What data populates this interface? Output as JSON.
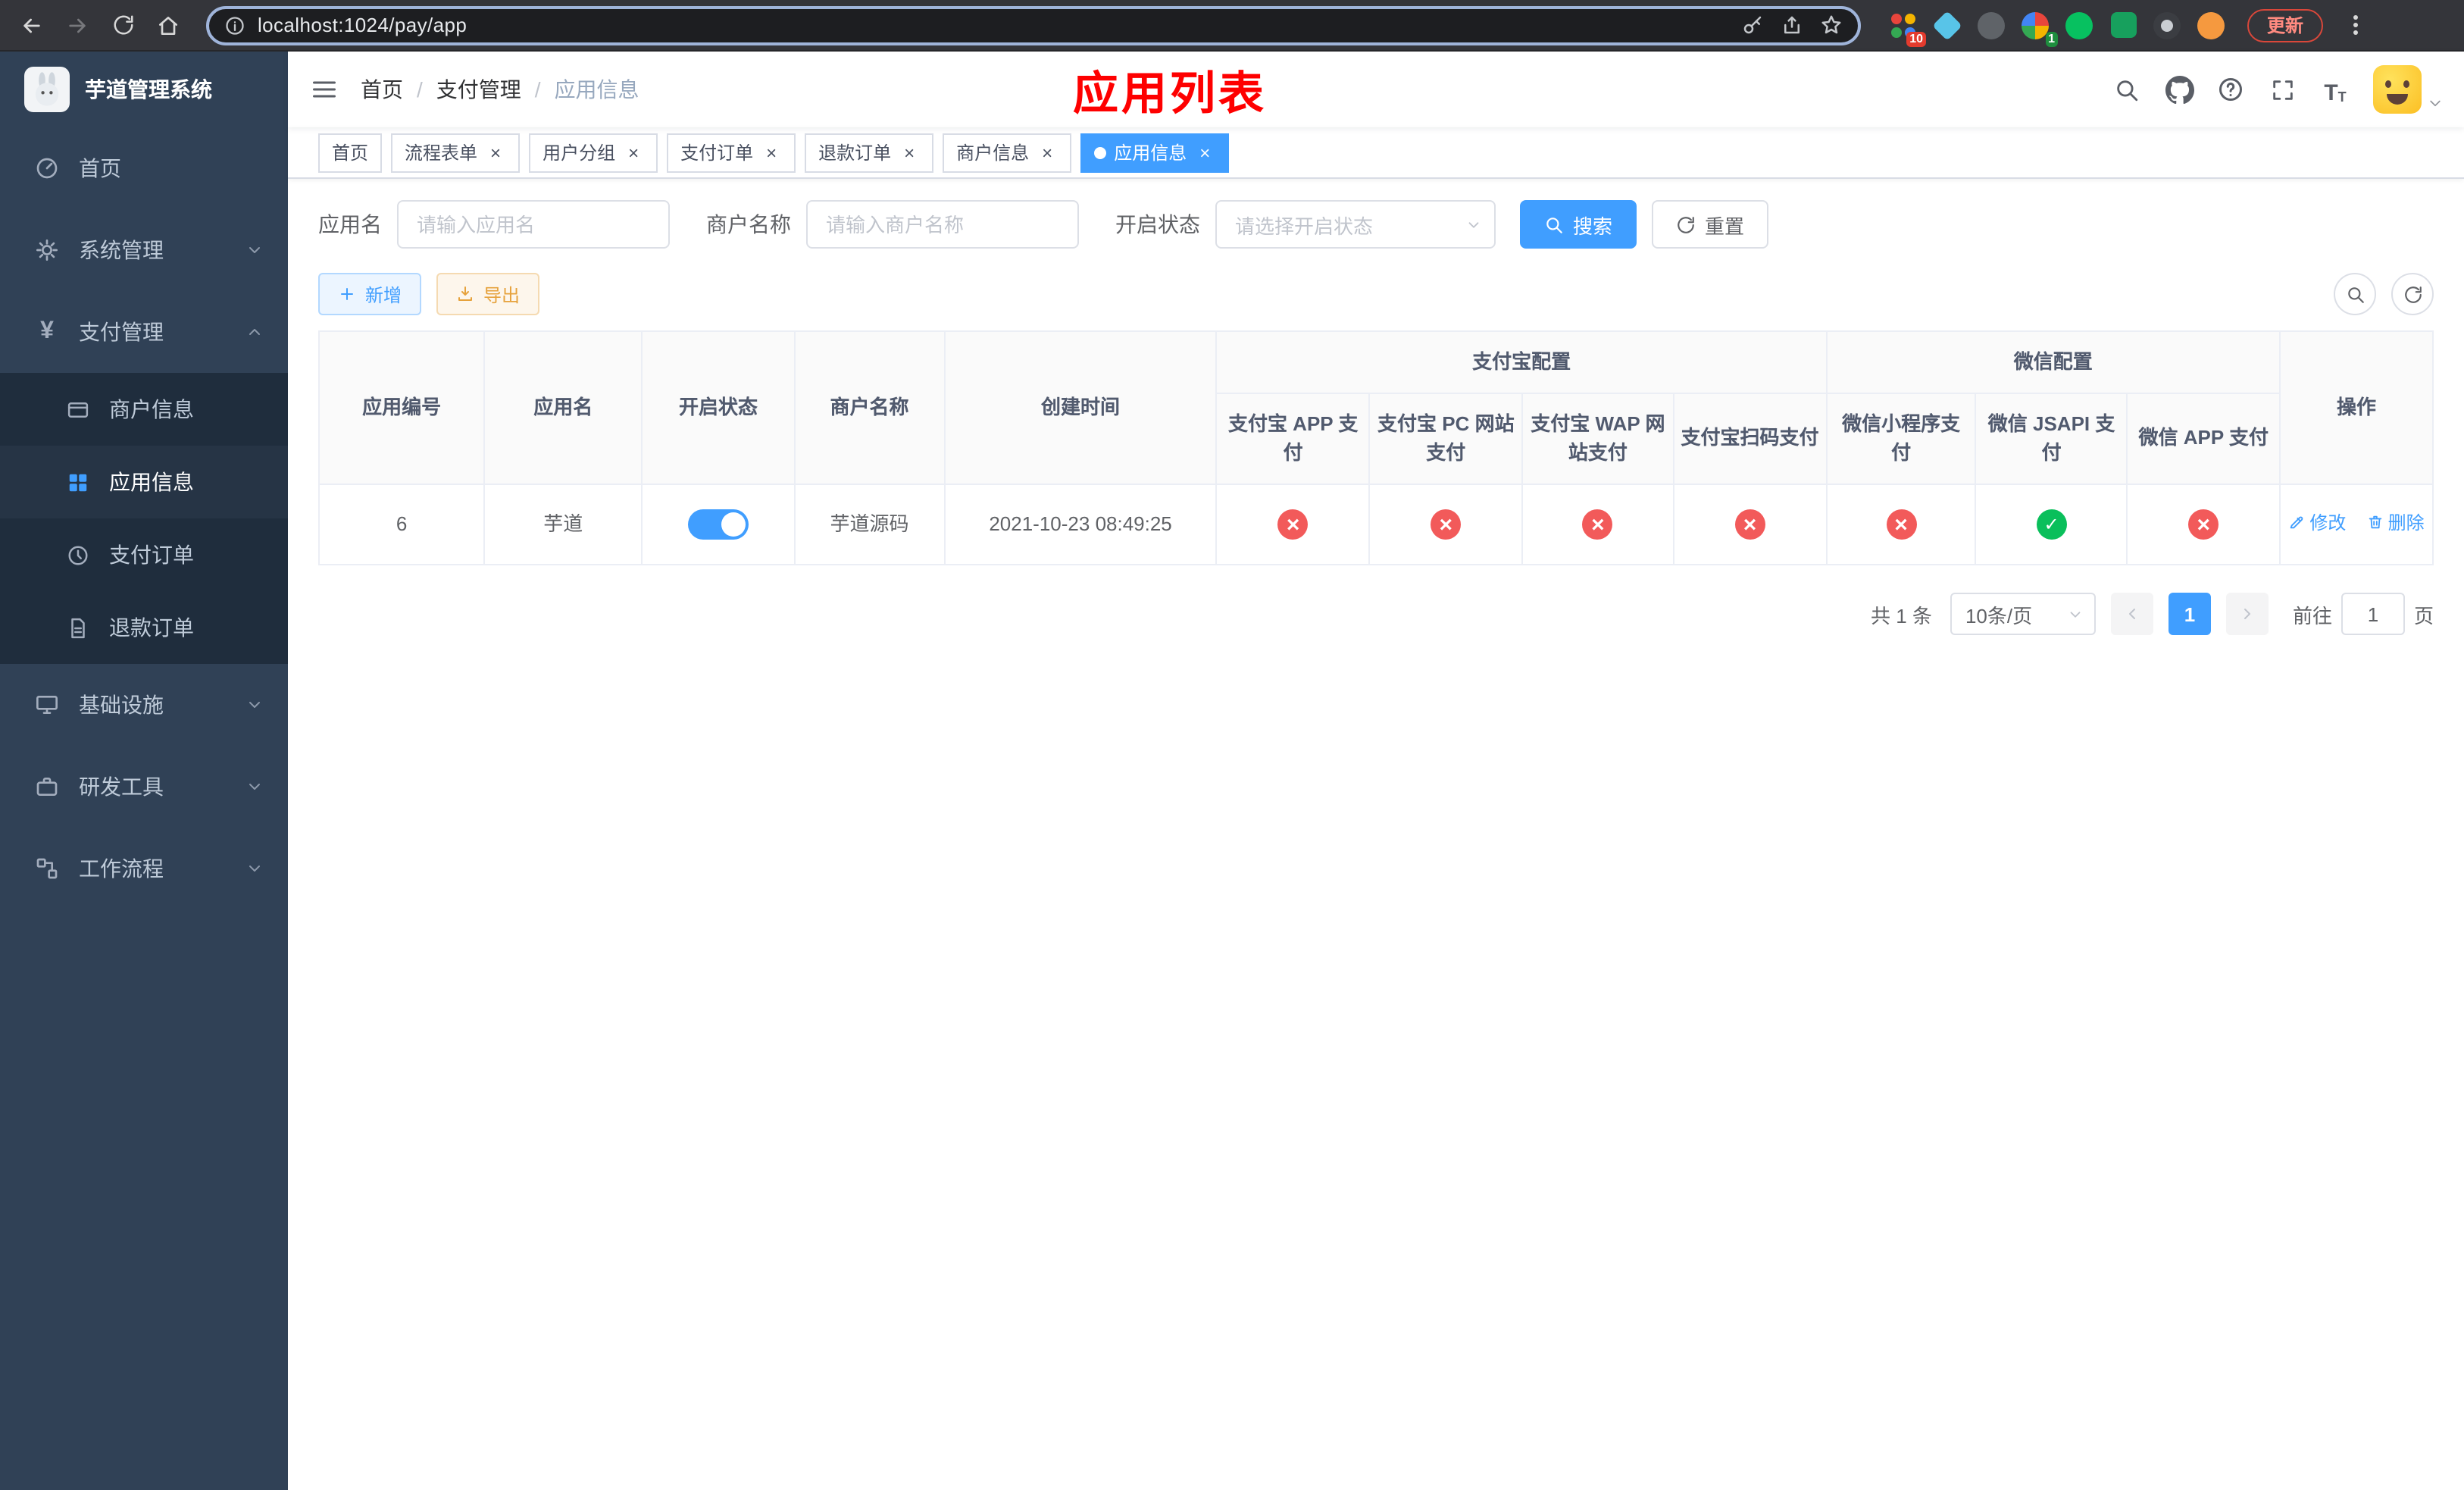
{
  "browser": {
    "url": "localhost:1024/pay/app",
    "update_label": "更新",
    "ext_badge_10": "10",
    "ext_badge_1": "1"
  },
  "sidebar": {
    "logo_title": "芋道管理系统",
    "items": [
      {
        "label": "首页"
      },
      {
        "label": "系统管理"
      },
      {
        "label": "支付管理"
      },
      {
        "label": "商户信息"
      },
      {
        "label": "应用信息"
      },
      {
        "label": "支付订单"
      },
      {
        "label": "退款订单"
      },
      {
        "label": "基础设施"
      },
      {
        "label": "研发工具"
      },
      {
        "label": "工作流程"
      }
    ]
  },
  "header": {
    "breadcrumb": [
      "首页",
      "支付管理",
      "应用信息"
    ],
    "page_title": "应用列表"
  },
  "tabs": [
    {
      "label": "首页"
    },
    {
      "label": "流程表单"
    },
    {
      "label": "用户分组"
    },
    {
      "label": "支付订单"
    },
    {
      "label": "退款订单"
    },
    {
      "label": "商户信息"
    },
    {
      "label": "应用信息"
    }
  ],
  "filters": {
    "app_name": {
      "label": "应用名",
      "placeholder": "请输入应用名",
      "value": ""
    },
    "merchant_name": {
      "label": "商户名称",
      "placeholder": "请输入商户名称",
      "value": ""
    },
    "status": {
      "label": "开启状态",
      "placeholder": "请选择开启状态",
      "value": ""
    },
    "search_button": "搜索",
    "reset_button": "重置"
  },
  "toolbar": {
    "add_button": "新增",
    "export_button": "导出"
  },
  "table": {
    "group_alipay": "支付宝配置",
    "group_wechat": "微信配置",
    "col_app_id": "应用编号",
    "col_app_name": "应用名",
    "col_status": "开启状态",
    "col_merchant": "商户名称",
    "col_create_time": "创建时间",
    "col_alipay_app": "支付宝 APP 支付",
    "col_alipay_pc": "支付宝 PC 网站支付",
    "col_alipay_wap": "支付宝 WAP 网站支付",
    "col_alipay_qr": "支付宝扫码支付",
    "col_wx_lite": "微信小程序支付",
    "col_wx_jsapi": "微信 JSAPI 支付",
    "col_wx_app": "微信 APP 支付",
    "col_actions": "操作",
    "rows": [
      {
        "app_id": "6",
        "app_name": "芋道",
        "status_enabled": true,
        "merchant_name": "芋道源码",
        "create_time": "2021-10-23 08:49:25",
        "channels": {
          "alipay_app": false,
          "alipay_pc": false,
          "alipay_wap": false,
          "alipay_qr": false,
          "wx_lite": false,
          "wx_jsapi": true,
          "wx_app": false
        },
        "edit_button": "修改",
        "delete_button": "删除"
      }
    ]
  },
  "pagination": {
    "total_text": "共 1 条",
    "page_size_text": "10条/页",
    "current_page": "1",
    "goto_label": "前往",
    "goto_value": "1",
    "goto_unit": "页"
  },
  "colors": {
    "primary": "#409eff",
    "danger": "#f25a5a",
    "success": "#0abf5b",
    "warning": "#e6a23c",
    "title_red": "#fe0000",
    "sidebar_bg": "#304156",
    "submenu_bg": "#1f2d3d"
  },
  "icons": {
    "channel_enabled_glyph": "✓",
    "channel_disabled_glyph": "×",
    "tab_close_glyph": "×"
  }
}
